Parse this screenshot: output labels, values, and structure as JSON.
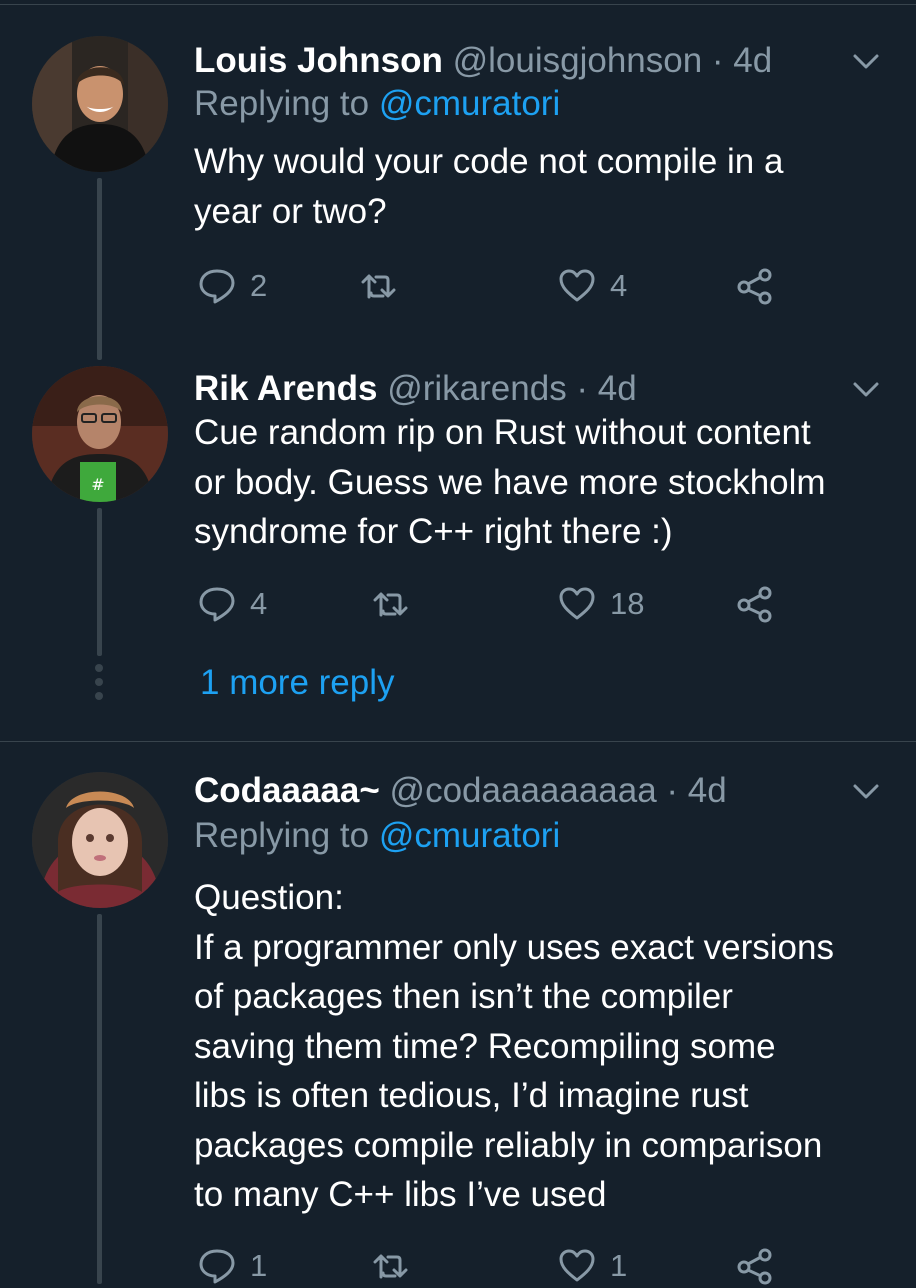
{
  "tweets": [
    {
      "name": "Louis Johnson",
      "handle": "@louisgjohnson · 4d",
      "replying_prefix": "Replying to ",
      "replying_to": "@cmuratori",
      "lines": [
        "Why would your code not compile in a",
        "year or two?"
      ],
      "reply_count": "2",
      "retweet_count": "",
      "like_count": "4"
    },
    {
      "name": "Rik Arends",
      "handle": "@rikarends · 4d",
      "lines": [
        "Cue random rip on Rust without content",
        "or body. Guess we have more stockholm",
        "syndrome for C++ right there :)"
      ],
      "reply_count": "4",
      "retweet_count": "",
      "like_count": "18"
    },
    {
      "name": "Codaaaaa~",
      "handle": "@codaaaaaaaaa · 4d",
      "replying_prefix": "Replying to ",
      "replying_to": "@cmuratori",
      "lines": [
        "Question:",
        "If a programmer only uses exact versions",
        "of packages then isn’t the compiler",
        "saving them time? Recompiling some",
        "libs is often tedious, I’d imagine rust",
        "packages compile reliably in comparison",
        "to many C++ libs I’ve used"
      ],
      "reply_count": "1",
      "retweet_count": "",
      "like_count": "1"
    }
  ],
  "more_replies": "1 more reply",
  "icons": {
    "reply": "reply-icon",
    "retweet": "retweet-icon",
    "like": "heart-icon",
    "share": "share-icon",
    "menu": "chevron-down-icon"
  },
  "colors": {
    "background": "#15202b",
    "secondary_text": "#8899a6",
    "accent": "#1da1f2",
    "divider": "#38444d"
  }
}
